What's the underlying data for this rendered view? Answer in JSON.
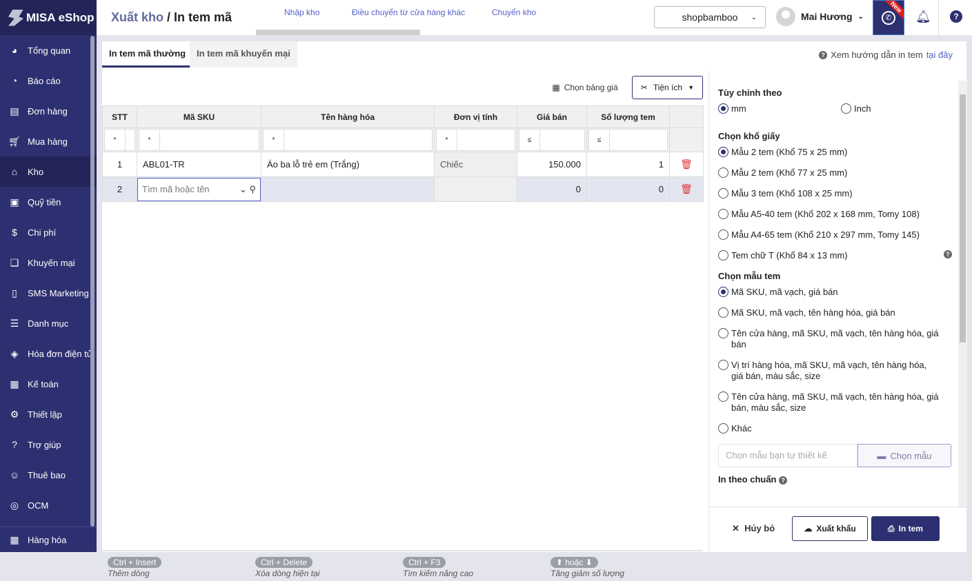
{
  "app": {
    "logo": "MISA eShop"
  },
  "sidebar": {
    "items": [
      {
        "label": "Tổng quan",
        "icon": "dashboard-icon"
      },
      {
        "label": "Báo cáo",
        "icon": "pie-chart-icon"
      },
      {
        "label": "Đơn hàng",
        "icon": "order-icon"
      },
      {
        "label": "Mua hàng",
        "icon": "cart-icon"
      },
      {
        "label": "Kho",
        "icon": "warehouse-icon",
        "active": true
      },
      {
        "label": "Quỹ tiền",
        "icon": "safe-icon"
      },
      {
        "label": "Chi phí",
        "icon": "money-bag-icon"
      },
      {
        "label": "Khuyến mại",
        "icon": "gift-icon"
      },
      {
        "label": "SMS Marketing",
        "icon": "phone-icon"
      },
      {
        "label": "Danh mục",
        "icon": "list-icon"
      },
      {
        "label": "Hóa đơn điện tử",
        "icon": "invoice-icon"
      },
      {
        "label": "Kế toán",
        "icon": "calculator-icon"
      },
      {
        "label": "Thiết lập",
        "icon": "gear-icon"
      },
      {
        "label": "Trợ giúp",
        "icon": "help-icon"
      },
      {
        "label": "Thuê bao",
        "icon": "user-icon"
      },
      {
        "label": "OCM",
        "icon": "ocm-icon"
      }
    ],
    "bottom": {
      "label": "Hàng hóa",
      "icon": "goods-icon"
    }
  },
  "header": {
    "title_prefix": "Xuất kho",
    "title_sep": " / ",
    "title": "In tem mã",
    "tabs": [
      "Nhập kho",
      "Điều chuyển từ cửa hàng khác",
      "Chuyển kho"
    ],
    "shop": "shopbamboo",
    "user": "Mai Hương",
    "new_badge": "New"
  },
  "content": {
    "tabs": [
      "In tem mã thường",
      "In tem mã khuyến mại"
    ],
    "guide_text": "Xem hướng dẫn in tem",
    "guide_link": "tại đây",
    "toolbar": {
      "price_table": "Chọn bảng giá",
      "utilities": "Tiện ích"
    },
    "table": {
      "columns": [
        "STT",
        "Mã SKU",
        "Tên hàng hóa",
        "Đơn vị tính",
        "Giá bán",
        "Số lượng tem"
      ],
      "filter_ops": [
        "*",
        "*",
        "*",
        "*",
        "≤",
        "≤"
      ],
      "rows": [
        {
          "stt": "1",
          "sku": "ABL01-TR",
          "name": "Áo ba lỗ trẻ em (Trắng)",
          "unit": "Chiếc",
          "price": "150.000",
          "qty": "1"
        },
        {
          "stt": "2",
          "sku_placeholder": "Tìm mã hoặc tên",
          "name": "",
          "unit": "",
          "price": "0",
          "qty": "0"
        }
      ]
    },
    "shortcuts": [
      {
        "key": "Ctrl + Insert",
        "desc": "Thêm dòng"
      },
      {
        "key": "Ctrl + Delete",
        "desc": "Xóa dòng hiện tại"
      },
      {
        "key": "Ctrl + F3",
        "desc": "Tìm kiếm nâng cao"
      },
      {
        "key": "⬆ hoặc ⬇",
        "desc": "Tăng giảm số lượng"
      }
    ]
  },
  "panel": {
    "unit_title": "Tùy chỉnh theo",
    "units": [
      {
        "label": "mm",
        "checked": true
      },
      {
        "label": "Inch",
        "checked": false
      }
    ],
    "paper_title": "Chọn khổ giấy",
    "papers": [
      {
        "label": "Mẫu 2 tem (Khổ 75 x 25 mm)",
        "checked": true
      },
      {
        "label": "Mẫu 2 tem (Khổ 77 x 25 mm)"
      },
      {
        "label": "Mẫu 3 tem (Khổ 108 x 25 mm)"
      },
      {
        "label": "Mẫu A5-40 tem (Khổ 202 x 168 mm, Tomy 108)"
      },
      {
        "label": "Mẫu A4-65 tem (Khổ 210 x 297 mm, Tomy 145)"
      },
      {
        "label": "Tem chữ T (Khổ 84 x 13 mm)"
      }
    ],
    "template_title": "Chọn mẫu tem",
    "templates": [
      {
        "label": "Mã SKU, mã vạch, giá bán",
        "checked": true
      },
      {
        "label": "Mã SKU, mã vạch, tên hàng hóa, giá bán"
      },
      {
        "label": "Tên cửa hàng, mã SKU, mã vạch, tên hàng hóa, giá bán"
      },
      {
        "label": "Vị trí hàng hóa, mã SKU, mã vạch, tên hàng hóa, giá bán, màu sắc, size"
      },
      {
        "label": "Tên cửa hàng, mã SKU, mã vạch, tên hàng hóa, giá bán, màu sắc, size"
      },
      {
        "label": "Khác"
      }
    ],
    "custom_placeholder": "Chọn mẫu bạn tự thiết kế",
    "custom_button": "Chọn mẫu",
    "standard_title": "In theo chuẩn",
    "actions": {
      "cancel": "Hủy bỏ",
      "export": "Xuất khẩu",
      "print": "In tem"
    }
  },
  "colors": {
    "primary": "#2d3070",
    "link": "#5560c8",
    "delete": "#e03030"
  }
}
